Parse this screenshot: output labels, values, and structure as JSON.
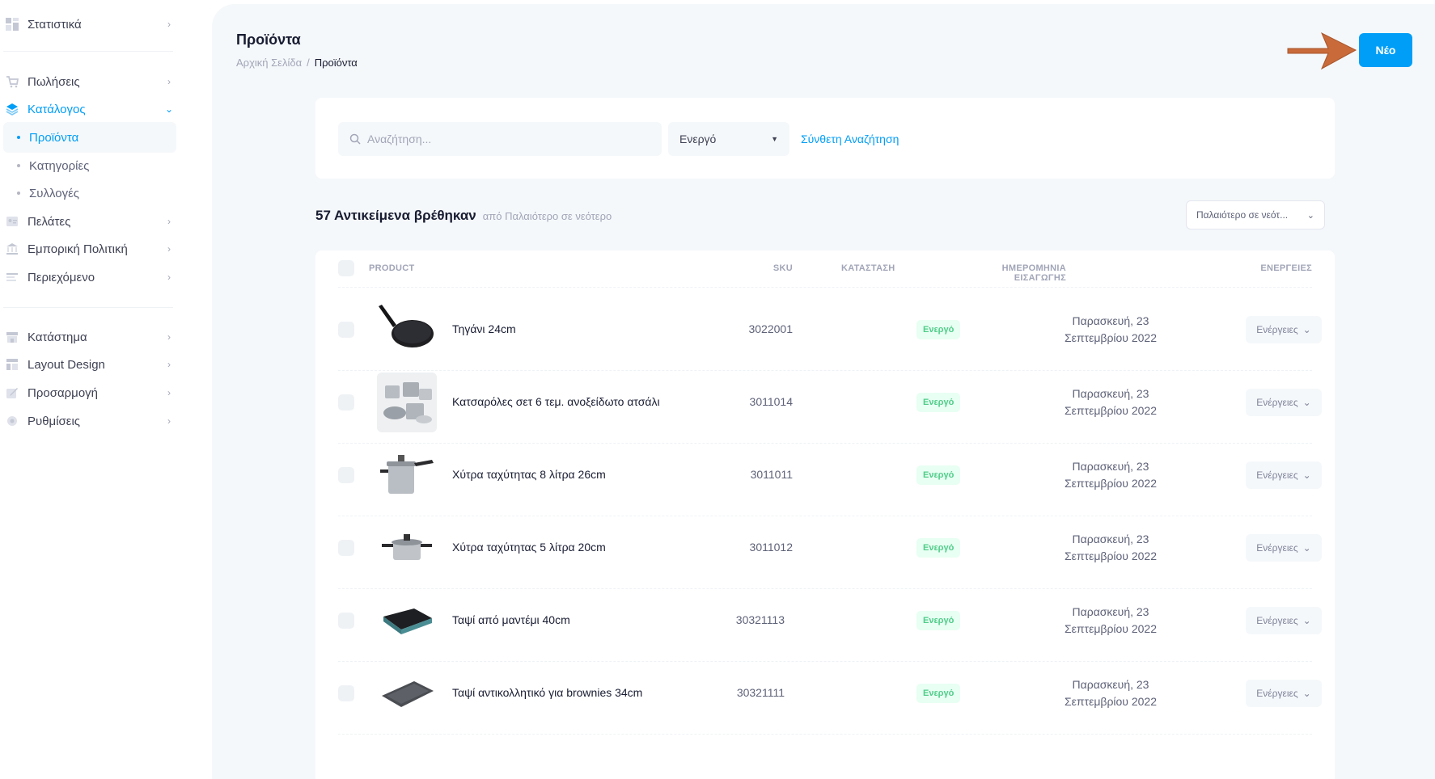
{
  "sidebar": {
    "items": [
      {
        "label": "Στατιστικά",
        "icon": "dashboard-icon"
      },
      {
        "label": "Πωλήσεις",
        "icon": "cart-icon"
      },
      {
        "label": "Κατάλογος",
        "icon": "layers-icon"
      },
      {
        "label": "Πελάτες",
        "icon": "users-icon"
      },
      {
        "label": "Εμπορική Πολιτική",
        "icon": "bank-icon"
      },
      {
        "label": "Περιεχόμενο",
        "icon": "text-lines-icon"
      },
      {
        "label": "Κατάστημα",
        "icon": "store-icon"
      },
      {
        "label": "Layout Design",
        "icon": "layout-icon"
      },
      {
        "label": "Προσαρμογή",
        "icon": "edit-icon"
      },
      {
        "label": "Ρυθμίσεις",
        "icon": "gear-icon"
      }
    ],
    "catalog_sub": [
      "Προϊόντα",
      "Κατηγορίες",
      "Συλλογές"
    ]
  },
  "header": {
    "title": "Προϊόντα",
    "breadcrumb": [
      "Αρχική Σελίδα",
      "/",
      "Προϊόντα"
    ],
    "new_button": "Νέο"
  },
  "filters": {
    "search_placeholder": "Αναζήτηση...",
    "status_value": "Ενεργό",
    "advanced_link": "Σύνθετη Αναζήτηση"
  },
  "results": {
    "count_text": "57 Αντικείμενα βρέθηκαν",
    "order_text": "από Παλαιότερο σε νεότερο",
    "sort_value": "Παλαιότερο σε νεότ..."
  },
  "table": {
    "columns": [
      "PRODUCT",
      "SKU",
      "ΚΑΤΑΣΤΑΣΗ",
      "ΗΜΕΡΟΜΗΝΙΑ ΕΙΣΑΓΩΓΗΣ",
      "ΕΝΕΡΓΕΙΕΣ"
    ],
    "rows": [
      {
        "name": "Τηγάνι 24cm",
        "sku": "3022001",
        "status": "Ενεργό",
        "date1": "Παρασκευή, 23",
        "date2": "Σεπτεμβρίου 2022",
        "actions": "Ενέργειες"
      },
      {
        "name": "Κατσαρόλες σετ 6 τεμ. ανοξείδωτο ατσάλι",
        "sku": "3011014",
        "status": "Ενεργό",
        "date1": "Παρασκευή, 23",
        "date2": "Σεπτεμβρίου 2022",
        "actions": "Ενέργειες"
      },
      {
        "name": "Χύτρα ταχύτητας 8 λίτρα 26cm",
        "sku": "3011011",
        "status": "Ενεργό",
        "date1": "Παρασκευή, 23",
        "date2": "Σεπτεμβρίου 2022",
        "actions": "Ενέργειες"
      },
      {
        "name": "Χύτρα ταχύτητας 5 λίτρα 20cm",
        "sku": "3011012",
        "status": "Ενεργό",
        "date1": "Παρασκευή, 23",
        "date2": "Σεπτεμβρίου 2022",
        "actions": "Ενέργειες"
      },
      {
        "name": "Ταψί από μαντέμι 40cm",
        "sku": "30321113",
        "status": "Ενεργό",
        "date1": "Παρασκευή, 23",
        "date2": "Σεπτεμβρίου 2022",
        "actions": "Ενέργειες"
      },
      {
        "name": "Ταψί αντικολλητικό για brownies 34cm",
        "sku": "30321111",
        "status": "Ενεργό",
        "date1": "Παρασκευή, 23",
        "date2": "Σεπτεμβρίου 2022",
        "actions": "Ενέργειες"
      }
    ]
  },
  "colors": {
    "accent": "#009ef7",
    "success": "#50cd89",
    "arrow": "#c86a3a"
  }
}
